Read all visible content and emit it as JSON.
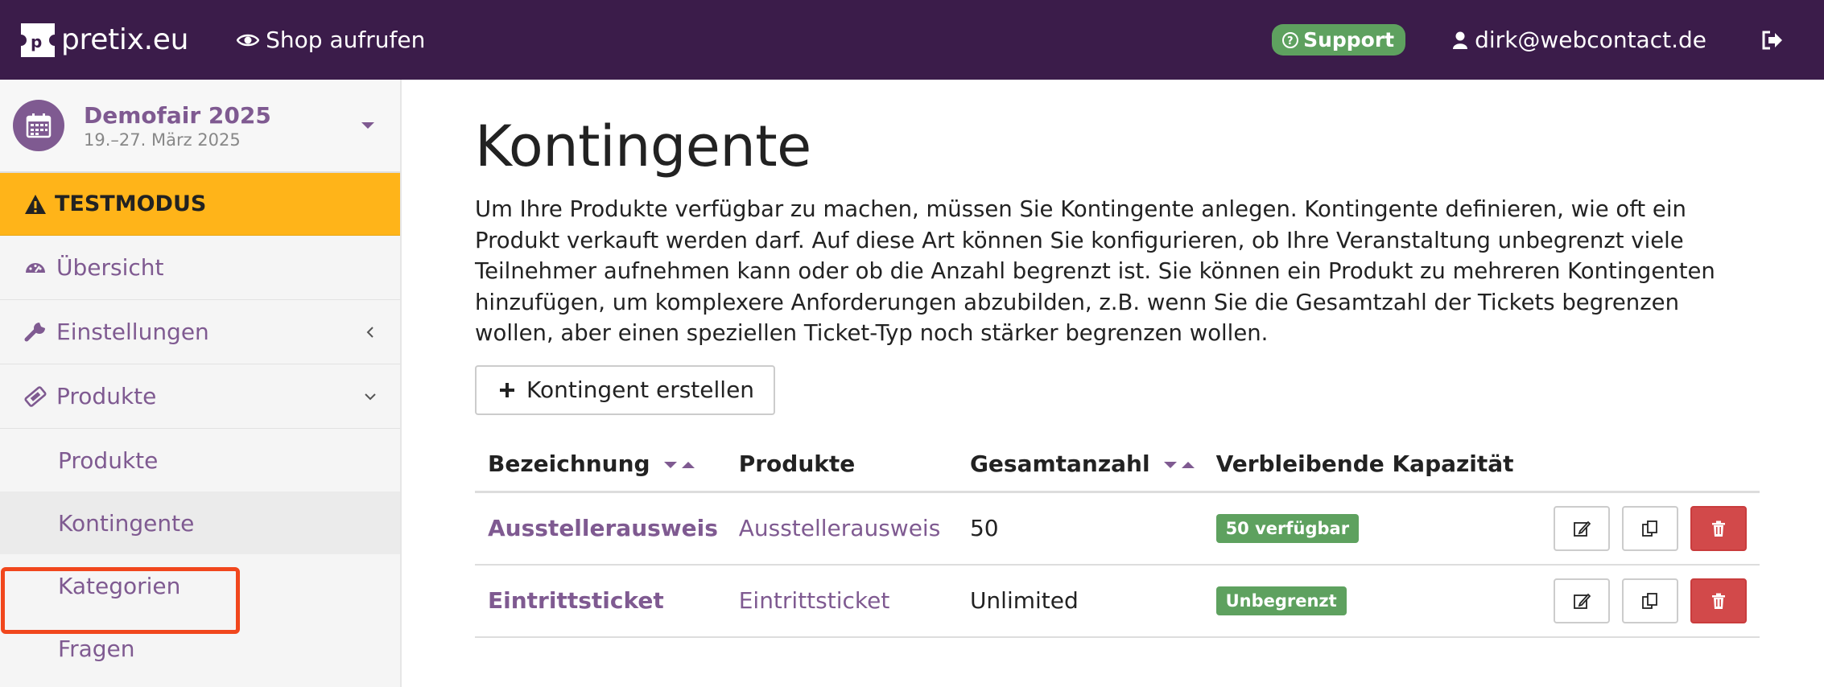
{
  "topbar": {
    "brand": "pretix.eu",
    "shop_link": "Shop aufrufen",
    "support": "Support",
    "user": "dirk@webcontact.de"
  },
  "sidebar": {
    "event": {
      "name": "Demofair 2025",
      "date": "19.–27. März 2025"
    },
    "testmode": "TESTMODUS",
    "items": [
      {
        "label": "Übersicht",
        "icon": "dashboard-icon"
      },
      {
        "label": "Einstellungen",
        "icon": "wrench-icon"
      },
      {
        "label": "Produkte",
        "icon": "ticket-icon"
      }
    ],
    "sub_items": [
      {
        "label": "Produkte"
      },
      {
        "label": "Kontingente",
        "active": true
      },
      {
        "label": "Kategorien"
      },
      {
        "label": "Fragen"
      }
    ]
  },
  "main": {
    "title": "Kontingente",
    "intro": "Um Ihre Produkte verfügbar zu machen, müssen Sie Kontingente anlegen. Kontingente definieren, wie oft ein Produkt verkauft werden darf. Auf diese Art können Sie konfigurieren, ob Ihre Veranstaltung unbegrenzt viele Teilnehmer aufnehmen kann oder ob die Anzahl begrenzt ist. Sie können ein Produkt zu mehreren Kontingenten hinzufügen, um komplexere Anforderungen abzubilden, z.B. wenn Sie die Gesamtzahl der Tickets begrenzen wollen, aber einen speziellen Ticket-Typ noch stärker begrenzen wollen.",
    "create_button": "Kontingent erstellen",
    "table": {
      "headers": [
        "Bezeichnung",
        "Produkte",
        "Gesamtanzahl",
        "Verbleibende Kapazität"
      ],
      "rows": [
        {
          "name": "Ausstellerausweis",
          "product": "Ausstellerausweis",
          "total": "50",
          "capacity": "50 verfügbar"
        },
        {
          "name": "Eintrittsticket",
          "product": "Eintrittsticket",
          "total": "Unlimited",
          "capacity": "Unbegrenzt"
        }
      ]
    }
  },
  "colors": {
    "topbar": "#3b1c4a",
    "accent": "#7f5a91",
    "success": "#5ea15f",
    "warning": "#ffb419",
    "danger": "#d2494a",
    "highlight": "#f1471d"
  }
}
